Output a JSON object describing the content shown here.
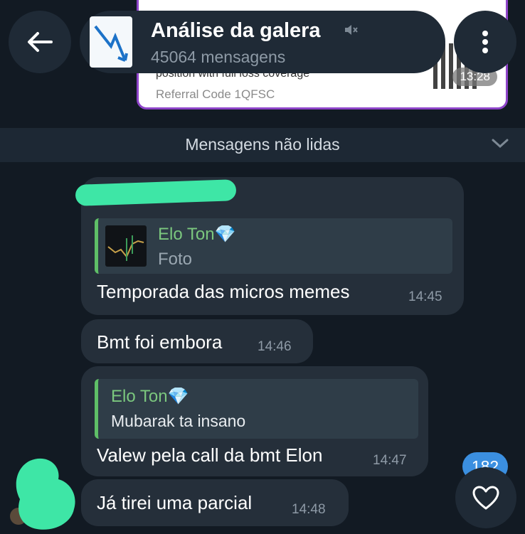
{
  "pinned_promo": {
    "line": "position with full loss coverage",
    "referral": "Referral Code 1QFSC",
    "time": "13:28"
  },
  "header": {
    "back_icon": "arrow-left-icon",
    "title": "Análise da galera",
    "subtitle": "45064 mensagens",
    "mute_icon": "mute-icon",
    "menu_icon": "more-vertical-icon"
  },
  "unread_bar": {
    "label": "Mensagens não lidas",
    "chevron_icon": "chevron-down-icon"
  },
  "messages": [
    {
      "quote": {
        "author": "Elo Ton💎",
        "body": "Foto"
      },
      "text": "Temporada das micros memes",
      "time": "14:45"
    },
    {
      "text": "Bmt foi embora",
      "time": "14:46"
    },
    {
      "quote": {
        "author": "Elo Ton💎",
        "body": "Mubarak ta insano"
      },
      "text": "Valew pela call da bmt Elon",
      "time": "14:47"
    },
    {
      "text": "Já tirei uma parcial",
      "time": "14:48"
    }
  ],
  "reactions_badge": {
    "count": "182"
  },
  "fab": {
    "icon": "heart-icon"
  },
  "colors": {
    "background": "#121a23",
    "bubble": "#252f3a",
    "quote_author": "#7bc77e",
    "badge": "#3b8fe0",
    "redaction": "#3ee6a6",
    "promo_border": "#8e44c9"
  }
}
